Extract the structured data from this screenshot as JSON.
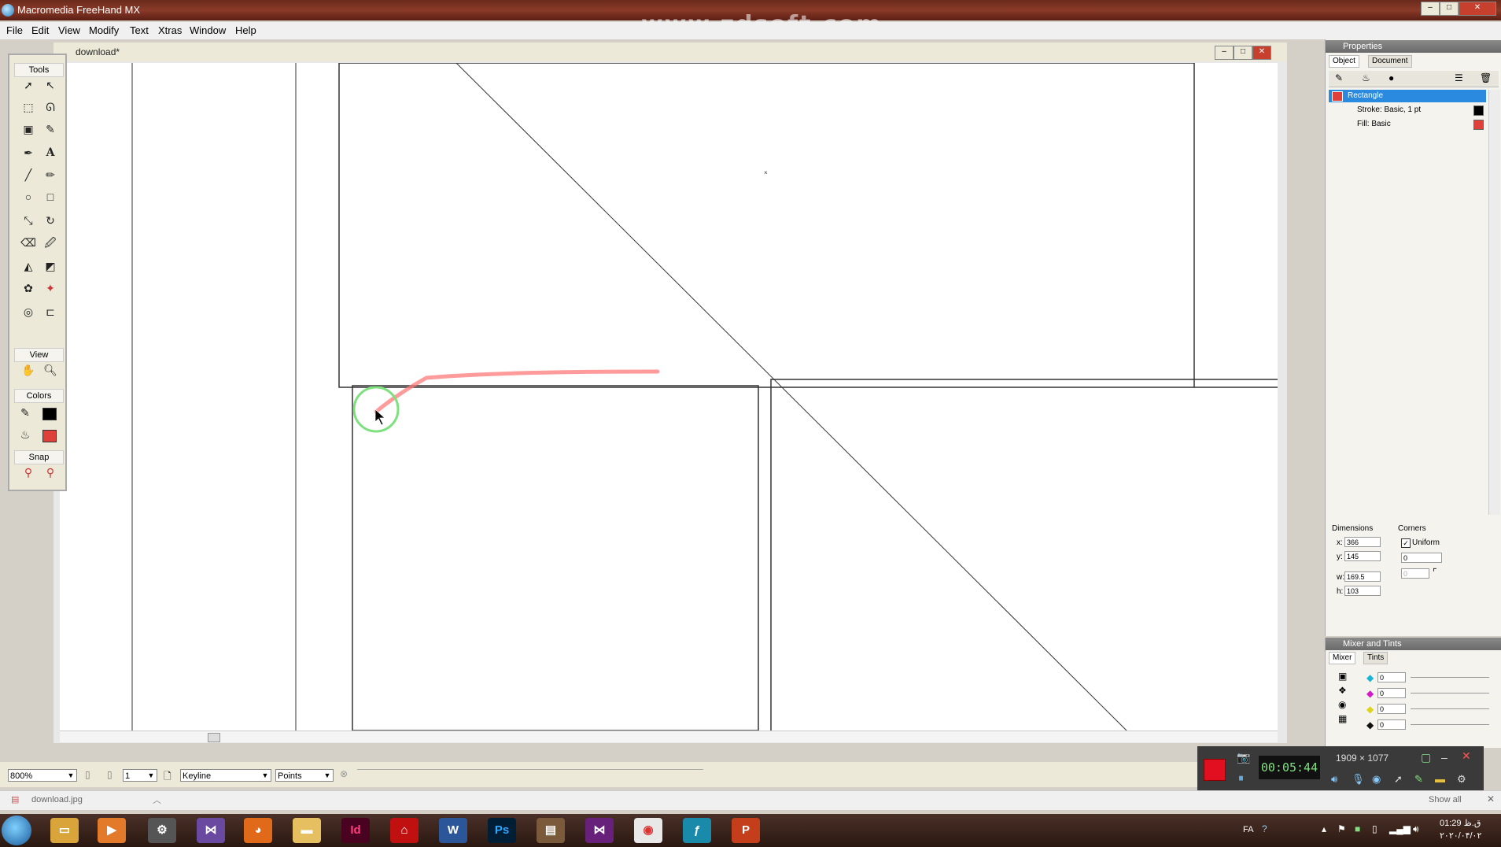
{
  "window": {
    "title": "Macromedia FreeHand MX",
    "watermark": "www.zdsoft.com",
    "min_label": "–",
    "max_label": "□",
    "close_label": "✕"
  },
  "menu": [
    "File",
    "Edit",
    "View",
    "Modify",
    "Text",
    "Xtras",
    "Window",
    "Help"
  ],
  "document": {
    "title": "download*",
    "min_label": "–",
    "max_label": "□",
    "close_label": "✕"
  },
  "tools_panel": {
    "title": "Tools",
    "view_title": "View",
    "colors_title": "Colors",
    "snap_title": "Snap",
    "stroke_color": "#000000",
    "fill_color": "#e0403a"
  },
  "statusbar": {
    "zoom": "800%",
    "page": "1",
    "view_mode": "Keyline",
    "units": "Points"
  },
  "properties": {
    "title": "Properties",
    "tabs": [
      "Object",
      "Document"
    ],
    "selected_object": "Rectangle",
    "stroke": "Stroke: Basic, 1 pt",
    "fill": "Fill: Basic",
    "stroke_color": "#000000",
    "fill_color": "#e0403a",
    "dimensions_label": "Dimensions",
    "corners_label": "Corners",
    "uniform_label": "Uniform",
    "x_label": "x:",
    "y_label": "y:",
    "w_label": "w:",
    "h_label": "h:",
    "x": "366",
    "y": "145",
    "w": "169.5",
    "h": "103",
    "corner_radius": "0",
    "corner_radius2": "0"
  },
  "mixer": {
    "title": "Mixer and Tints",
    "tabs": [
      "Mixer",
      "Tints"
    ],
    "values": [
      "0",
      "0",
      "0",
      "0"
    ],
    "channel_colors": [
      "#19b5d6",
      "#d419c8",
      "#e0d41a",
      "#111111"
    ]
  },
  "recorder": {
    "resolution": "1909 × 1077",
    "time": "00:05:44"
  },
  "downloads": {
    "file": "download.jpg",
    "show_all": "Show all"
  },
  "taskbar": {
    "lang": "FA",
    "time": "01:29 ق.ظ",
    "date": "۲۰۲۰/۰۴/۰۲"
  }
}
